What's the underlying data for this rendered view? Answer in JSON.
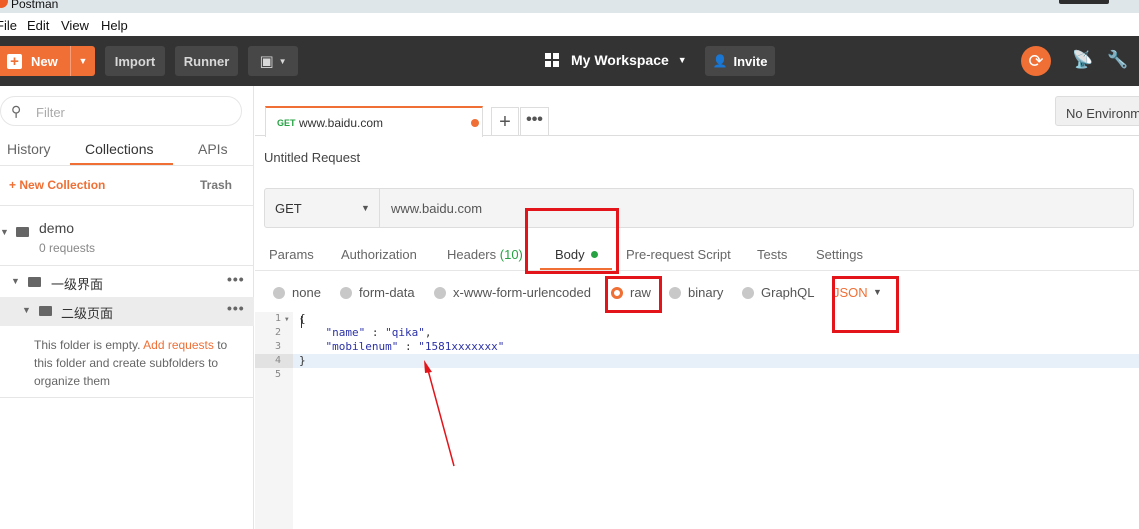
{
  "window": {
    "title": "Postman"
  },
  "menu": {
    "items": [
      "File",
      "Edit",
      "View",
      "Help"
    ]
  },
  "toolbar": {
    "new_label": "New",
    "import_label": "Import",
    "runner_label": "Runner",
    "workspace_label": "My Workspace",
    "invite_label": "Invite",
    "accent_color": "#EF6F35"
  },
  "sidebar": {
    "filter_placeholder": "Filter",
    "tabs": [
      "History",
      "Collections",
      "APIs"
    ],
    "active_tab": "Collections",
    "new_collection_label": "+ New Collection",
    "trash_label": "Trash",
    "collection": {
      "name": "demo",
      "count": "0 requests"
    },
    "folders": [
      {
        "label": "一级界面",
        "more": "•••"
      },
      {
        "label": "二级页面",
        "more": "•••"
      }
    ],
    "empty_message": "This folder is empty.",
    "empty_link": "Add requests",
    "empty_message_rest": "to this folder and create subfolders to organize them"
  },
  "request_tab": {
    "method": "GET",
    "url": "www.baidu.com",
    "add": "+",
    "more": "•••"
  },
  "environment": {
    "label": "No Environment"
  },
  "request": {
    "title": "Untitled Request",
    "method": "GET",
    "url": "www.baidu.com",
    "tabs": {
      "params": "Params",
      "auth": "Authorization",
      "headers": "Headers",
      "headers_count": "(10)",
      "body": "Body",
      "prerequest": "Pre-request Script",
      "tests": "Tests",
      "settings": "Settings"
    },
    "body_types": {
      "none": "none",
      "form_data": "form-data",
      "urlencoded": "x-www-form-urlencoded",
      "raw": "raw",
      "binary": "binary",
      "graphql": "GraphQL"
    },
    "selected_body_type": "raw",
    "format": "JSON"
  },
  "editor": {
    "line_numbers": [
      "1",
      "2",
      "3",
      "4",
      "5"
    ],
    "lines": {
      "l1": "{",
      "l2_key": "\"name\"",
      "l2_sep": " : ",
      "l2_val": "\"qika\"",
      "l2_end": ",",
      "l3_key": "\"mobilenum\"",
      "l3_sep": " : ",
      "l3_val": "\"1581xxxxxxx\"",
      "l4": "}"
    }
  },
  "colors": {
    "annotation_red": "#E3141A",
    "success_green": "#26A243"
  }
}
